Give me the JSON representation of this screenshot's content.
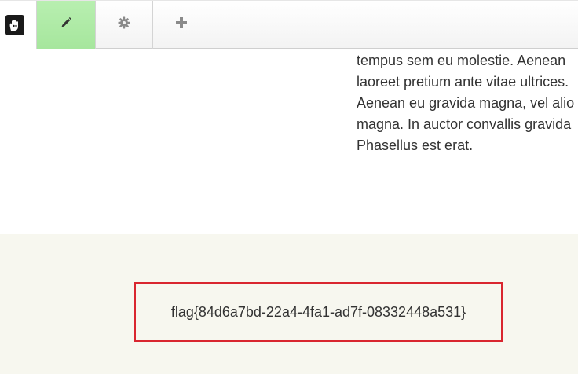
{
  "toolbar": {
    "items": [
      {
        "name": "logo",
        "icon": "hand-logo-icon"
      },
      {
        "name": "edit",
        "icon": "pencil-icon",
        "active": true
      },
      {
        "name": "settings",
        "icon": "gear-icon"
      },
      {
        "name": "add",
        "icon": "plus-icon"
      }
    ],
    "active_color": "#a6e69d"
  },
  "content": {
    "lines": [
      "tempus sem eu molestie. Aenean",
      "laoreet pretium ante vitae ultrices.",
      "Aenean eu gravida magna, vel alio",
      "magna. In auctor convallis gravida",
      "Phasellus est erat."
    ]
  },
  "footer": {
    "flag_text": "flag{84d6a7bd-22a4-4fa1-ad7f-08332448a531}",
    "background": "#f7f7ef",
    "border_color": "#d9262f"
  }
}
